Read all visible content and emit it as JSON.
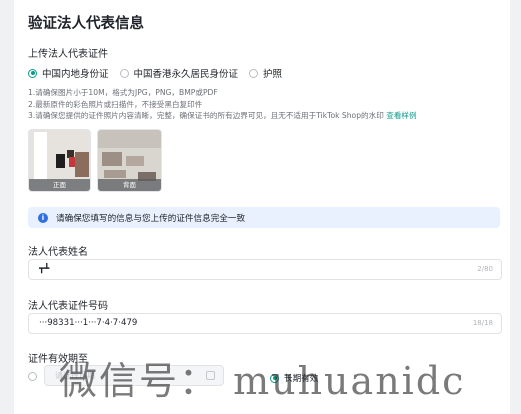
{
  "page": {
    "title": "验证法人代表信息"
  },
  "upload": {
    "label": "上传法人代表证件",
    "options": [
      {
        "label": "中国内地身份证",
        "selected": true
      },
      {
        "label": "中国香港永久居民身份证",
        "selected": false
      },
      {
        "label": "护照",
        "selected": false
      }
    ],
    "rules": [
      "1.请确保图片小于10M，格式为JPG，PNG，BMP或PDF",
      "2.最新原件的彩色照片或扫描件，不接受黑白复印件",
      "3.请确保您提供的证件照片内容清晰，完整，确保证书的所有边界可见，且无不适用于TikTok Shop的水印"
    ],
    "sample_link": "查看样例",
    "images": [
      {
        "caption": "正面"
      },
      {
        "caption": "背面"
      }
    ]
  },
  "notice": {
    "text": "请确保您填写的信息与您上传的证件信息完全一致",
    "icon": "info-icon"
  },
  "name_field": {
    "label": "法人代表姓名",
    "value": "┳┻",
    "counter": "2/80"
  },
  "id_field": {
    "label": "法人代表证件号码",
    "value": "···98331···1···7·4·7·479",
    "counter": "18/18"
  },
  "validity": {
    "label": "证件有效期至",
    "date_placeholder": "请选择日期",
    "long_term_label": "长期有效",
    "long_term_selected": true
  },
  "watermark": {
    "text": "微信号：  muhuanidc"
  },
  "colors": {
    "accent": "#0b9b8a",
    "notice_bg": "#e8f1fd",
    "info": "#2f6fe0"
  }
}
